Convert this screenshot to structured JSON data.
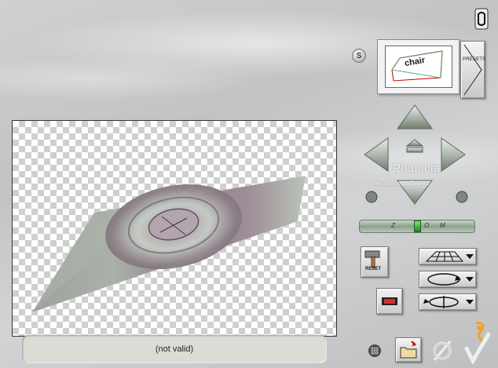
{
  "status": {
    "text": "(not valid)"
  },
  "presets": {
    "s_label": "S",
    "presets_label": "PRESETS",
    "thumb_text": "chair"
  },
  "tools": {
    "reset_label": "RESET"
  },
  "watermark": {
    "name": "Pinuccia",
    "url": "www.mairiegrafica.eu"
  },
  "slider": {
    "letters": [
      "Z",
      "O",
      "M"
    ],
    "value": 0.5
  },
  "icons": [
    "logo-icon",
    "arrow-up-icon",
    "arrow-down-icon",
    "arrow-left-icon",
    "arrow-right-icon",
    "center-icon",
    "rotate-left-icon",
    "rotate-right-icon",
    "reset-hammer-icon",
    "perspective-grid-icon",
    "rotate-horizontal-icon",
    "rotate-vertical-icon",
    "film-icon",
    "grid-icon",
    "open-folder-icon",
    "cancel-icon",
    "ok-check-icon"
  ],
  "colors": {
    "background": "#c8c9cb",
    "status_bg": "#dcdcd7",
    "slider_green": "#2fa82f"
  }
}
